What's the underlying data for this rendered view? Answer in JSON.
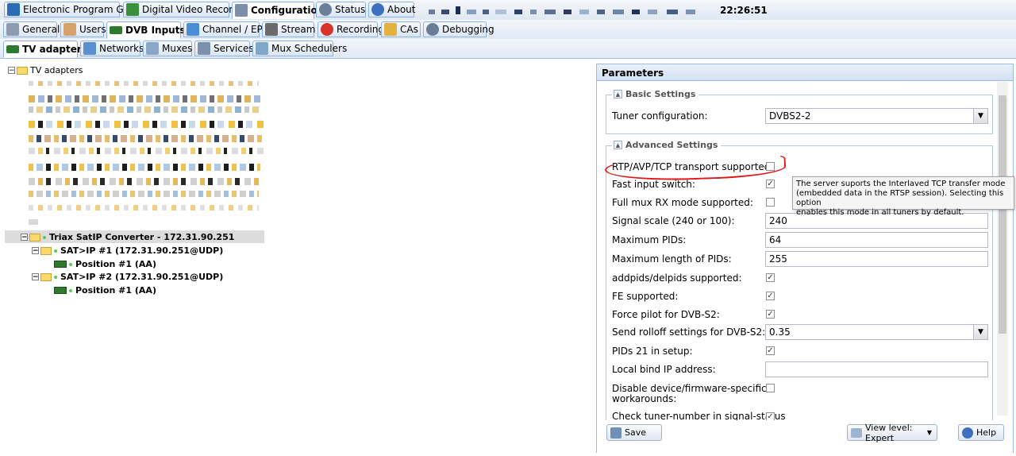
{
  "top_tabs": [
    {
      "label": "Electronic Program Guide",
      "icon": "epg-icon",
      "color": "#2a6db5"
    },
    {
      "label": "Digital Video Recorder",
      "icon": "dvr-download-icon",
      "color": "#3c8f3c"
    },
    {
      "label": "Configuration",
      "icon": "wrench-icon",
      "color": "#7d8fa8"
    },
    {
      "label": "Status",
      "icon": "eye-icon",
      "color": "#6a7f9a"
    },
    {
      "label": "About",
      "icon": "info-icon",
      "color": "#3d6fbf"
    }
  ],
  "clock": "22:26:51",
  "config_tabs": [
    {
      "label": "General",
      "icon": "tools-icon"
    },
    {
      "label": "Users",
      "icon": "users-icon"
    },
    {
      "label": "DVB Inputs",
      "icon": "dvb-card-icon"
    },
    {
      "label": "Channel / EPG",
      "icon": "tv-icon"
    },
    {
      "label": "Stream",
      "icon": "stream-icon"
    },
    {
      "label": "Recording",
      "icon": "rec-icon"
    },
    {
      "label": "CAs",
      "icon": "key-icon"
    },
    {
      "label": "Debugging",
      "icon": "bug-icon"
    }
  ],
  "dvb_tabs": [
    {
      "label": "TV adapters",
      "icon": "tuner-card-icon"
    },
    {
      "label": "Networks",
      "icon": "antenna-icon"
    },
    {
      "label": "Muxes",
      "icon": "mux-icon"
    },
    {
      "label": "Services",
      "icon": "services-icon"
    },
    {
      "label": "Mux Schedulers",
      "icon": "scheduler-icon"
    }
  ],
  "tree": {
    "root": "TV adapters",
    "converter": "Triax SatIP Converter - 172.31.90.251",
    "satip1": "SAT>IP #1 (172.31.90.251@UDP)",
    "satip1_pos": "Position #1 (AA)",
    "satip2": "SAT>IP #2 (172.31.90.251@UDP)",
    "satip2_pos": "Position #1 (AA)"
  },
  "params": {
    "title": "Parameters",
    "basic_legend": "Basic Settings",
    "tuner_label": "Tuner configuration:",
    "tuner_value": "DVBS2-2",
    "advanced_legend": "Advanced Settings",
    "rtp_label": "RTP/AVP/TCP transport supported:",
    "fast_label": "Fast input switch:",
    "fullmux_label": "Full mux RX mode supported:",
    "signal_label": "Signal scale (240 or 100):",
    "signal_value": "240",
    "maxpids_label": "Maximum PIDs:",
    "maxpids_value": "64",
    "maxlen_label": "Maximum length of PIDs:",
    "maxlen_value": "255",
    "addpids_label": "addpids/delpids supported:",
    "fe_label": "FE supported:",
    "pilot_label": "Force pilot for DVB-S2:",
    "rolloff_label": "Send rolloff settings for DVB-S2:",
    "rolloff_value": "0.35",
    "pids21_label": "PIDs 21 in setup:",
    "bind_label": "Local bind IP address:",
    "bind_value": "",
    "disable_label_1": "Disable device/firmware-specific",
    "disable_label_2": "workarounds:",
    "check_label": "Check tuner-number in signal-status"
  },
  "tooltip": {
    "line1": "The server suports the Interlaved TCP transfer mode",
    "line2": "(embedded data in the RTSP session). Selecting this option",
    "line3": "enables this mode in all tuners by default."
  },
  "footer": {
    "save": "Save",
    "view_level": "View level: Expert",
    "help": "Help"
  },
  "check_mark": "✓"
}
